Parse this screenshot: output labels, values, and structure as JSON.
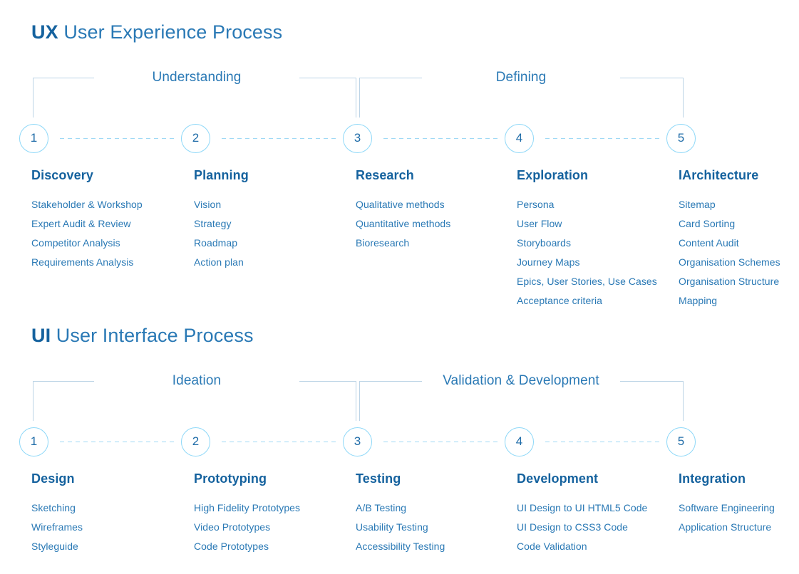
{
  "colors": {
    "heading": "#15629e",
    "item": "#2a79b5",
    "rail": "#bcd4e6",
    "dash": "#9fd9f5",
    "circle_border": "#8ed8f8",
    "background": "#ffffff"
  },
  "sections": [
    {
      "id": "ux",
      "abbr": "UX",
      "title": " User Experience Process",
      "groups": [
        {
          "label": "Understanding"
        },
        {
          "label": "Defining"
        }
      ],
      "steps": [
        "1",
        "2",
        "3",
        "4",
        "5"
      ],
      "columns": [
        {
          "heading": "Discovery",
          "items": [
            "Stakeholder & Workshop",
            "Expert Audit & Review",
            "Competitor Analysis",
            "Requirements Analysis"
          ]
        },
        {
          "heading": "Planning",
          "items": [
            "Vision",
            "Strategy",
            "Roadmap",
            "Action plan"
          ]
        },
        {
          "heading": "Research",
          "items": [
            "Qualitative methods",
            "Quantitative methods",
            "Bioresearch"
          ]
        },
        {
          "heading": "Exploration",
          "items": [
            "Persona",
            "User Flow",
            "Storyboards",
            "Journey Maps",
            "Epics, User Stories, Use Cases",
            "Acceptance criteria"
          ]
        },
        {
          "heading": "IArchitecture",
          "items": [
            "Sitemap",
            "Card Sorting",
            "Content Audit",
            "Organisation Schemes",
            "Organisation Structure",
            "Mapping"
          ]
        }
      ]
    },
    {
      "id": "ui",
      "abbr": "UI",
      "title": " User Interface Process",
      "groups": [
        {
          "label": "Ideation"
        },
        {
          "label": "Validation & Development"
        }
      ],
      "steps": [
        "1",
        "2",
        "3",
        "4",
        "5"
      ],
      "columns": [
        {
          "heading": "Design",
          "items": [
            "Sketching",
            "Wireframes",
            "Styleguide"
          ]
        },
        {
          "heading": "Prototyping",
          "items": [
            "High Fidelity Prototypes",
            "Video Prototypes",
            "Code Prototypes"
          ]
        },
        {
          "heading": "Testing",
          "items": [
            "A/B Testing",
            "Usability Testing",
            "Accessibility Testing"
          ]
        },
        {
          "heading": "Development",
          "items": [
            "UI Design to UI HTML5 Code",
            "UI Design to CSS3 Code",
            "Code Validation"
          ]
        },
        {
          "heading": "Integration",
          "items": [
            "Software Engineering",
            "Application Structure"
          ]
        }
      ]
    }
  ]
}
